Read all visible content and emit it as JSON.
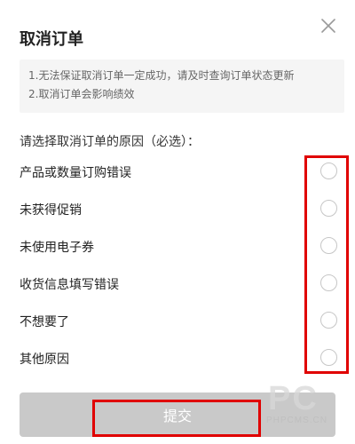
{
  "dialog": {
    "title": "取消订单",
    "close_icon": "close-icon"
  },
  "notice": {
    "lines": [
      "1.无法保证取消订单一定成功，请及时查询订单状态更新",
      "2.取消订单会影响绩效"
    ]
  },
  "prompt": "请选择取消订单的原因（必选）：",
  "reasons": [
    {
      "label": "产品或数量订购错误",
      "selected": false
    },
    {
      "label": "未获得促销",
      "selected": false
    },
    {
      "label": "未使用电子券",
      "selected": false
    },
    {
      "label": "收货信息填写错误",
      "selected": false
    },
    {
      "label": "不想要了",
      "selected": false
    },
    {
      "label": "其他原因",
      "selected": false
    }
  ],
  "submit_label": "提交",
  "watermark": {
    "big": "PC",
    "small": "PHPCMS.CN"
  },
  "colors": {
    "highlight": "#e00000",
    "submit_bg": "#c9c9c9",
    "notice_bg": "#f5f5f5",
    "radio_border": "#c6c6c6"
  }
}
